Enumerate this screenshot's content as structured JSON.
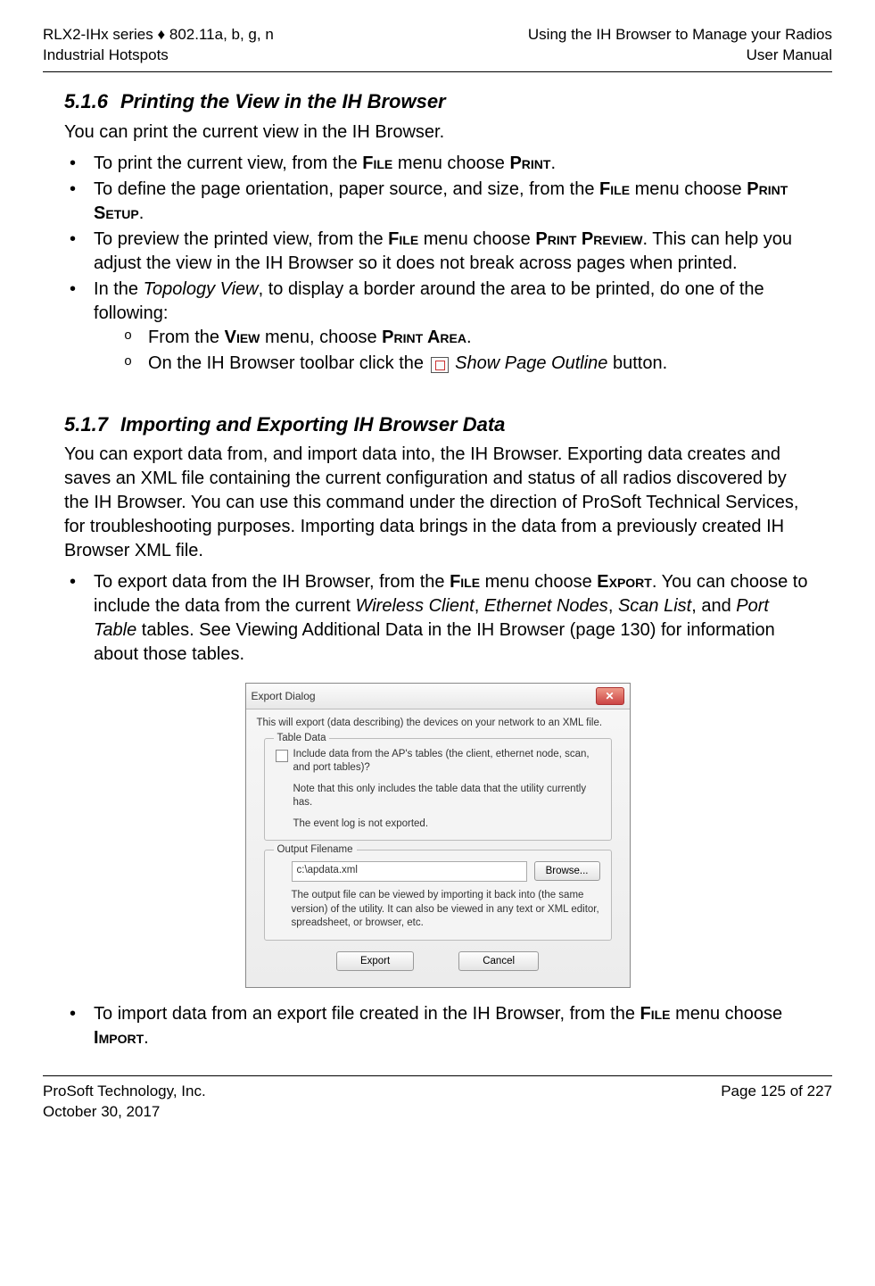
{
  "header": {
    "left1": "RLX2-IHx series ♦ 802.11a, b, g, n",
    "left2": "Industrial Hotspots",
    "right1": "Using the IH Browser to Manage your Radios",
    "right2": "User Manual"
  },
  "section516": {
    "num": "5.1.6",
    "title": "Printing the View in the IH Browser",
    "intro": "You can print the current view in the IH Browser.",
    "b1a": "To print the current view, from the ",
    "b1b": " menu choose ",
    "b1c": ".",
    "file": "File",
    "print": "Print",
    "b2a": "To define the page orientation, paper source, and size, from the ",
    "b2b": " menu choose ",
    "b2c": ".",
    "printsetup": "Print Setup",
    "b3a": "To preview the printed view, from the ",
    "b3b": " menu choose ",
    "b3c": ". This can help you adjust the view in the IH Browser so it does not break across pages when printed.",
    "printpreview": "Print Preview",
    "b4a": "In the ",
    "topview": "Topology View",
    "b4b": ", to display a border around the area to be printed, do one of the following:",
    "s1a": "From the ",
    "view": "View",
    "s1b": " menu, choose ",
    "printarea": "Print Area",
    "s1c": ".",
    "s2a": "On the IH Browser toolbar click the ",
    "showpage": "Show Page Outline",
    "s2b": " button."
  },
  "section517": {
    "num": "5.1.7",
    "title": "Importing and Exporting IH Browser Data",
    "intro": "You can export data from, and import data into, the IH Browser. Exporting data creates and saves an XML file containing the current configuration and status of all radios discovered by the IH Browser. You can use this command under the direction of ProSoft Technical Services, for troubleshooting purposes. Importing data brings in the data from a previously created IH Browser XML file.",
    "b1a": "To export data from the IH Browser, from the ",
    "file": "File",
    "b1b": " menu choose ",
    "export": "Export",
    "b1c": ". You can choose to include the data from the current ",
    "wc": "Wireless Client",
    "comma1": ", ",
    "en": "Ethernet Nodes",
    "comma2": ", ",
    "sl": "Scan List",
    "and": ", and ",
    "pt": "Port Table",
    "b1d": " tables. See Viewing Additional Data in the IH Browser (page 130) for information about those tables.",
    "b2a": "To import data from an export file created in the IH Browser, from the ",
    "b2b": " menu choose ",
    "import": "Import",
    "b2c": "."
  },
  "dialog": {
    "title": "Export Dialog",
    "intro": "This will export (data describing) the devices on your network to an XML file.",
    "group1": "Table Data",
    "chk": "Include data from the AP's tables (the client, ethernet node, scan, and port tables)?",
    "note1": "Note that this only includes the table data that the utility currently has.",
    "note2": "The event log is not exported.",
    "group2": "Output Filename",
    "file": "c:\\apdata.xml",
    "browse": "Browse...",
    "desc": "The output file can be viewed by importing it back into (the same version) of the utility.  It can also be viewed in any text or XML editor, spreadsheet, or browser, etc.",
    "export": "Export",
    "cancel": "Cancel"
  },
  "footer": {
    "left1": "ProSoft Technology, Inc.",
    "left2": "October 30, 2017",
    "right": "Page 125 of 227"
  }
}
